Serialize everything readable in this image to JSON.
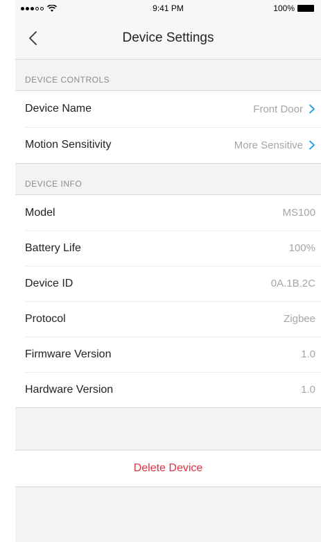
{
  "status_bar": {
    "time": "9:41 PM",
    "battery": "100%",
    "icons": [
      "signal-dots-icon",
      "wifi-icon",
      "battery-icon"
    ]
  },
  "nav": {
    "title": "Device Settings",
    "back_icon": "chevron-left-icon"
  },
  "sections": {
    "controls": {
      "header": "DEVICE CONTROLS",
      "rows": [
        {
          "label": "Device Name",
          "value": "Front Door"
        },
        {
          "label": "Motion Sensitivity",
          "value": "More Sensitive"
        }
      ]
    },
    "info": {
      "header": "DEVICE INFO",
      "rows": [
        {
          "label": "Model",
          "value": "MS100"
        },
        {
          "label": "Battery Life",
          "value": "100%"
        },
        {
          "label": "Device ID",
          "value": "0A.1B.2C"
        },
        {
          "label": "Protocol",
          "value": "Zigbee"
        },
        {
          "label": "Firmware Version",
          "value": "1.0"
        },
        {
          "label": "Hardware Version",
          "value": "1.0"
        }
      ]
    }
  },
  "actions": {
    "delete_label": "Delete Device"
  },
  "colors": {
    "accent_chevron": "#2aa3e6",
    "destructive": "#e0313e"
  }
}
